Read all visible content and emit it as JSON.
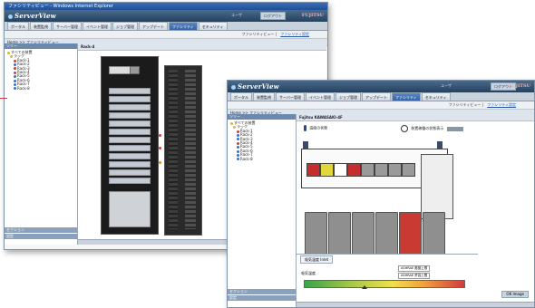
{
  "window1": {
    "title": "ファシリティビュー - Windows Internet Explorer",
    "brand": "ServerView",
    "user_label": "ユーザ",
    "logout": "ログアウト",
    "fujitsu": "FUJITSU",
    "tabs": [
      "ポータル",
      "装置監視",
      "サーバー管理",
      "イベント管理",
      "ジョブ管理",
      "アップデート",
      "ファシリティ",
      "セキュリティ"
    ],
    "subnav": {
      "current": "ファシリティビュー",
      "link": "ファシリティ設定"
    },
    "breadcrumb": "Home >> ファシリティビュー",
    "left_header": "ツリー",
    "tree": [
      {
        "label": "すべての装置",
        "color": "#e3b72b"
      },
      {
        "label": "ラック",
        "color": "#e3b72b"
      },
      {
        "label": "Rack-1",
        "color": "#d23b3b"
      },
      {
        "label": "Rack-2",
        "color": "#3a6fd0"
      },
      {
        "label": "Rack-3",
        "color": "#d23b3b"
      },
      {
        "label": "Rack-4",
        "color": "#d23b3b"
      },
      {
        "label": "Rack-5",
        "color": "#3a6fd0"
      },
      {
        "label": "Rack-6",
        "color": "#3a6fd0"
      },
      {
        "label": "Rack-7",
        "color": "#3a6fd0"
      },
      {
        "label": "Rack-8",
        "color": "#3a6fd0"
      }
    ],
    "footer_items": [
      "セクション",
      "設定"
    ],
    "main_title": "Rack-4",
    "server_count": 12
  },
  "window2": {
    "brand": "ServerView",
    "user_label": "ユーザ",
    "logout": "ログアウト",
    "fujitsu": "FUJITSU",
    "tabs": [
      "ポータル",
      "装置監視",
      "サーバー管理",
      "イベント管理",
      "ジョブ管理",
      "アップデート",
      "ファシリティ",
      "セキュリティ"
    ],
    "subnav": {
      "current": "ファシリティビュー",
      "link": "ファシリティ設定"
    },
    "breadcrumb": "Home >> ファシリティビュー",
    "left_header": "ツリー",
    "tree": [
      {
        "label": "すべての装置",
        "color": "#e3b72b"
      },
      {
        "label": "ラック",
        "color": "#e3b72b"
      },
      {
        "label": "Rack-1",
        "color": "#d23b3b"
      },
      {
        "label": "Rack-2",
        "color": "#3a6fd0"
      },
      {
        "label": "Rack-3",
        "color": "#3a6fd0"
      },
      {
        "label": "Rack-4",
        "color": "#d23b3b"
      },
      {
        "label": "Rack-5",
        "color": "#3a6fd0"
      },
      {
        "label": "Rack-6",
        "color": "#3a6fd0"
      },
      {
        "label": "Rack-7",
        "color": "#3a6fd0"
      },
      {
        "label": "Rack-8",
        "color": "#3a6fd0"
      }
    ],
    "footer_items": [
      "セクション",
      "設定"
    ],
    "main_title": "Fujitsu KAWASAKI-4F",
    "temp_label": "温度の状態",
    "legend_label": "装置稼働の状態表示",
    "gauge_tab": "吸気温度 Inlet",
    "gauge_caption_left": "吸気温度",
    "gauge_note1": "ASHRAE 推奨上限",
    "gauge_note2": "ASHRAE 許容上限",
    "button": "OK Image",
    "rack_colors": [
      "#c62d2d",
      "#e3d63a",
      "#ffffff",
      "#c62d2d",
      "#9a9a9a",
      "#9a9a9a",
      "#9a9a9a",
      "#9a9a9a"
    ],
    "cabinet_colors": [
      "#8f8f8f",
      "#8f8f8f",
      "#8f8f8f",
      "#8f8f8f",
      "#c93b32",
      "#8f8f8f"
    ]
  }
}
